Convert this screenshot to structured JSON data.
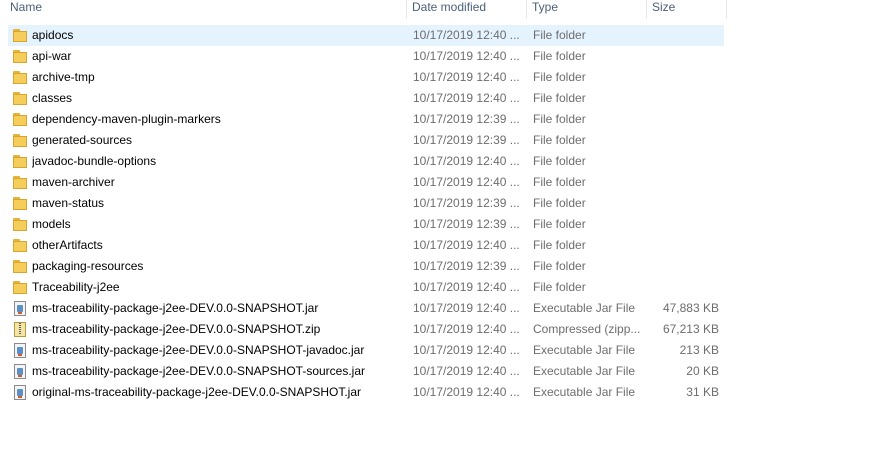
{
  "columns": {
    "name": "Name",
    "date": "Date modified",
    "type": "Type",
    "size": "Size"
  },
  "files": [
    {
      "name": "apidocs",
      "date": "10/17/2019 12:40 ...",
      "type": "File folder",
      "size": "",
      "icon": "folder-icon",
      "selected": true
    },
    {
      "name": "api-war",
      "date": "10/17/2019 12:40 ...",
      "type": "File folder",
      "size": "",
      "icon": "folder-icon"
    },
    {
      "name": "archive-tmp",
      "date": "10/17/2019 12:40 ...",
      "type": "File folder",
      "size": "",
      "icon": "folder-icon"
    },
    {
      "name": "classes",
      "date": "10/17/2019 12:40 ...",
      "type": "File folder",
      "size": "",
      "icon": "folder-icon"
    },
    {
      "name": "dependency-maven-plugin-markers",
      "date": "10/17/2019 12:39 ...",
      "type": "File folder",
      "size": "",
      "icon": "folder-icon"
    },
    {
      "name": "generated-sources",
      "date": "10/17/2019 12:39 ...",
      "type": "File folder",
      "size": "",
      "icon": "folder-icon"
    },
    {
      "name": "javadoc-bundle-options",
      "date": "10/17/2019 12:40 ...",
      "type": "File folder",
      "size": "",
      "icon": "folder-icon"
    },
    {
      "name": "maven-archiver",
      "date": "10/17/2019 12:40 ...",
      "type": "File folder",
      "size": "",
      "icon": "folder-icon"
    },
    {
      "name": "maven-status",
      "date": "10/17/2019 12:39 ...",
      "type": "File folder",
      "size": "",
      "icon": "folder-icon"
    },
    {
      "name": "models",
      "date": "10/17/2019 12:39 ...",
      "type": "File folder",
      "size": "",
      "icon": "folder-icon"
    },
    {
      "name": "otherArtifacts",
      "date": "10/17/2019 12:40 ...",
      "type": "File folder",
      "size": "",
      "icon": "folder-icon"
    },
    {
      "name": "packaging-resources",
      "date": "10/17/2019 12:39 ...",
      "type": "File folder",
      "size": "",
      "icon": "folder-icon"
    },
    {
      "name": "Traceability-j2ee",
      "date": "10/17/2019 12:40 ...",
      "type": "File folder",
      "size": "",
      "icon": "folder-icon"
    },
    {
      "name": "ms-traceability-package-j2ee-DEV.0.0-SNAPSHOT.jar",
      "date": "10/17/2019 12:40 ...",
      "type": "Executable Jar File",
      "size": "47,883 KB",
      "icon": "jar-file-icon"
    },
    {
      "name": "ms-traceability-package-j2ee-DEV.0.0-SNAPSHOT.zip",
      "date": "10/17/2019 12:40 ...",
      "type": "Compressed (zipp...",
      "size": "67,213 KB",
      "icon": "zip-file-icon"
    },
    {
      "name": "ms-traceability-package-j2ee-DEV.0.0-SNAPSHOT-javadoc.jar",
      "date": "10/17/2019 12:40 ...",
      "type": "Executable Jar File",
      "size": "213 KB",
      "icon": "jar-file-icon"
    },
    {
      "name": "ms-traceability-package-j2ee-DEV.0.0-SNAPSHOT-sources.jar",
      "date": "10/17/2019 12:40 ...",
      "type": "Executable Jar File",
      "size": "20 KB",
      "icon": "jar-file-icon"
    },
    {
      "name": "original-ms-traceability-package-j2ee-DEV.0.0-SNAPSHOT.jar",
      "date": "10/17/2019 12:40 ...",
      "type": "Executable Jar File",
      "size": "31 KB",
      "icon": "jar-file-icon"
    }
  ]
}
